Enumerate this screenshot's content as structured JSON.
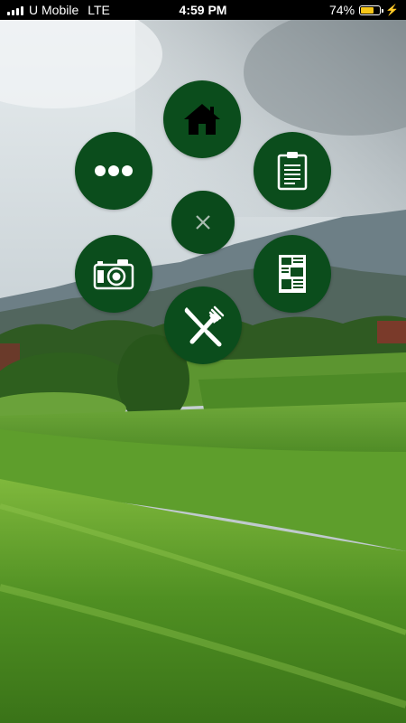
{
  "status_bar": {
    "carrier": "U Mobile",
    "network": "LTE",
    "time": "4:59 PM",
    "battery_percent": "74%",
    "battery_level": 0.74,
    "battery_color": "#f5c518"
  },
  "menu": {
    "accent_color": "#0b4d1c",
    "items": [
      {
        "name": "home",
        "icon": "home-icon"
      },
      {
        "name": "more",
        "icon": "more-dots-icon"
      },
      {
        "name": "clipboard",
        "icon": "clipboard-icon"
      },
      {
        "name": "close",
        "icon": "close-icon"
      },
      {
        "name": "camera",
        "icon": "camera-icon"
      },
      {
        "name": "news",
        "icon": "newspaper-icon"
      },
      {
        "name": "food",
        "icon": "knife-fork-icon"
      }
    ]
  }
}
